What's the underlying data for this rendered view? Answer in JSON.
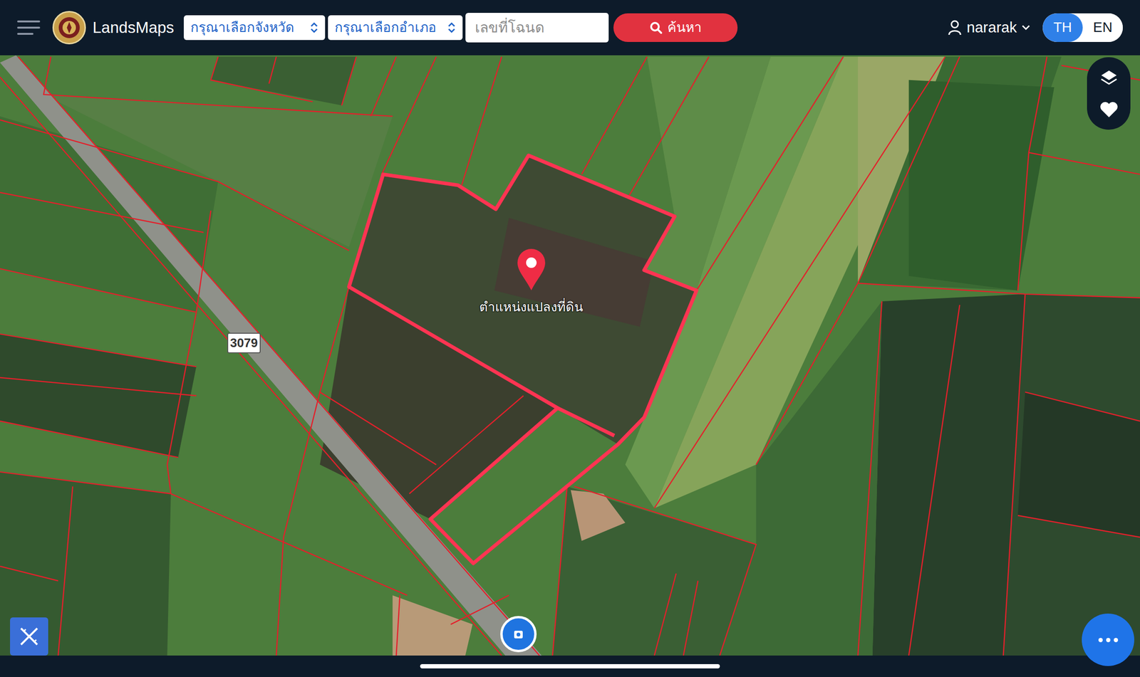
{
  "header": {
    "logo": "LandsMaps",
    "province_select": "กรุณาเลือกจังหวัด",
    "district_select": "กรุณาเลือกอำเภอ",
    "search": {
      "placeholder": "เลขที่โฉนด"
    },
    "search_button": "ค้นหา",
    "user": "nararak",
    "languages": [
      {
        "label": "TH",
        "selected": true
      },
      {
        "label": "EN",
        "selected": false
      }
    ]
  },
  "map": {
    "road_label": "3079",
    "marker_label": "ตำแหน่งแปลงที่ดิน"
  }
}
